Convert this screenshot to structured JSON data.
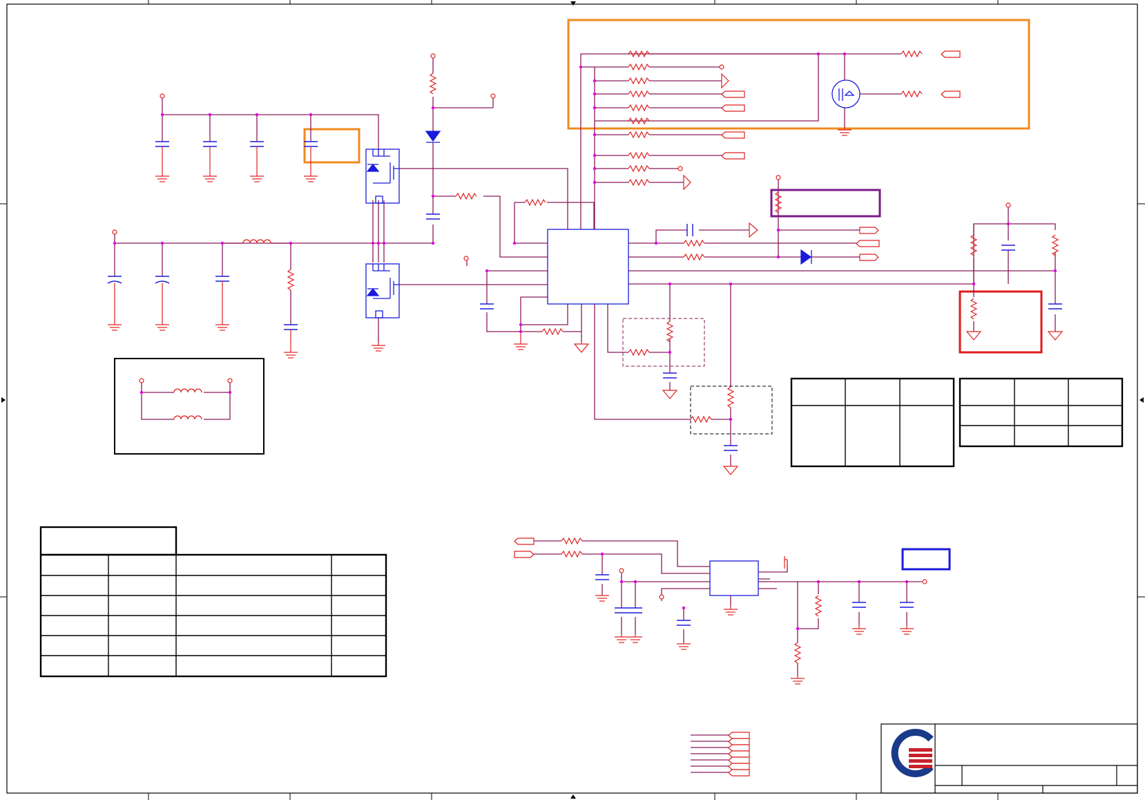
{
  "sheet": {
    "title": "",
    "border_color": "#000000"
  },
  "colors": {
    "wire": "#8b1a5a",
    "component": "#e02020",
    "ic": "#1a1adc",
    "junction": "#e000e0",
    "highlight_orange": "#f08a1c",
    "highlight_purple": "#7a1a8a",
    "highlight_red": "#e01a1a",
    "highlight_blue": "#1a1adc"
  },
  "icons": {
    "logo": "company-logo-icon",
    "ground": "ground-icon",
    "resistor": "resistor-icon",
    "capacitor": "capacitor-icon",
    "inductor": "inductor-icon",
    "diode": "diode-icon",
    "mosfet": "mosfet-icon",
    "port": "offpage-connector-icon"
  },
  "tables": {
    "table_a": {
      "columns": 3,
      "rows": 2
    },
    "table_b": {
      "columns": 3,
      "rows": 3
    },
    "revision_table": {
      "columns": 4,
      "rows": 6
    }
  }
}
